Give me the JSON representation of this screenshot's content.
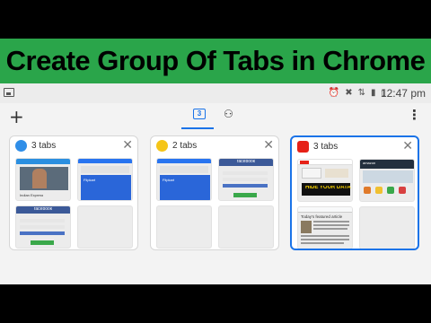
{
  "banner": {
    "title": "Create Group Of Tabs in Chrome"
  },
  "statusbar": {
    "time": "12:47 pm",
    "icons": [
      "alarm-icon",
      "mute-icon",
      "sync-icon",
      "signal-icon",
      "battery-icon"
    ]
  },
  "toolbar": {
    "tab_count": "3"
  },
  "groups": [
    {
      "title": "3 tabs",
      "favicon_color": "#2f8ee8",
      "close": "✕",
      "selected": false,
      "thumbs": [
        {
          "kind": "news",
          "text": "Indian Express"
        },
        {
          "kind": "flipkart",
          "text": "Flipkart"
        },
        {
          "kind": "facebook",
          "text": "facebook"
        }
      ]
    },
    {
      "title": "2 tabs",
      "favicon_color": "#f5c518",
      "close": "✕",
      "selected": false,
      "thumbs": [
        {
          "kind": "flipkart",
          "text": "Flipkart"
        },
        {
          "kind": "facebook",
          "text": "facebook"
        }
      ]
    },
    {
      "title": "3 tabs",
      "favicon_color": "#e62117",
      "close": "✕",
      "selected": true,
      "thumbs": [
        {
          "kind": "youtube",
          "text": "HIDE YOUR DATA"
        },
        {
          "kind": "amazon",
          "text": "amazon"
        },
        {
          "kind": "wiki",
          "text": "Today's featured article"
        }
      ]
    }
  ],
  "colors": {
    "accent": "#1a73e8",
    "banner_bg": "#2aa54a"
  }
}
